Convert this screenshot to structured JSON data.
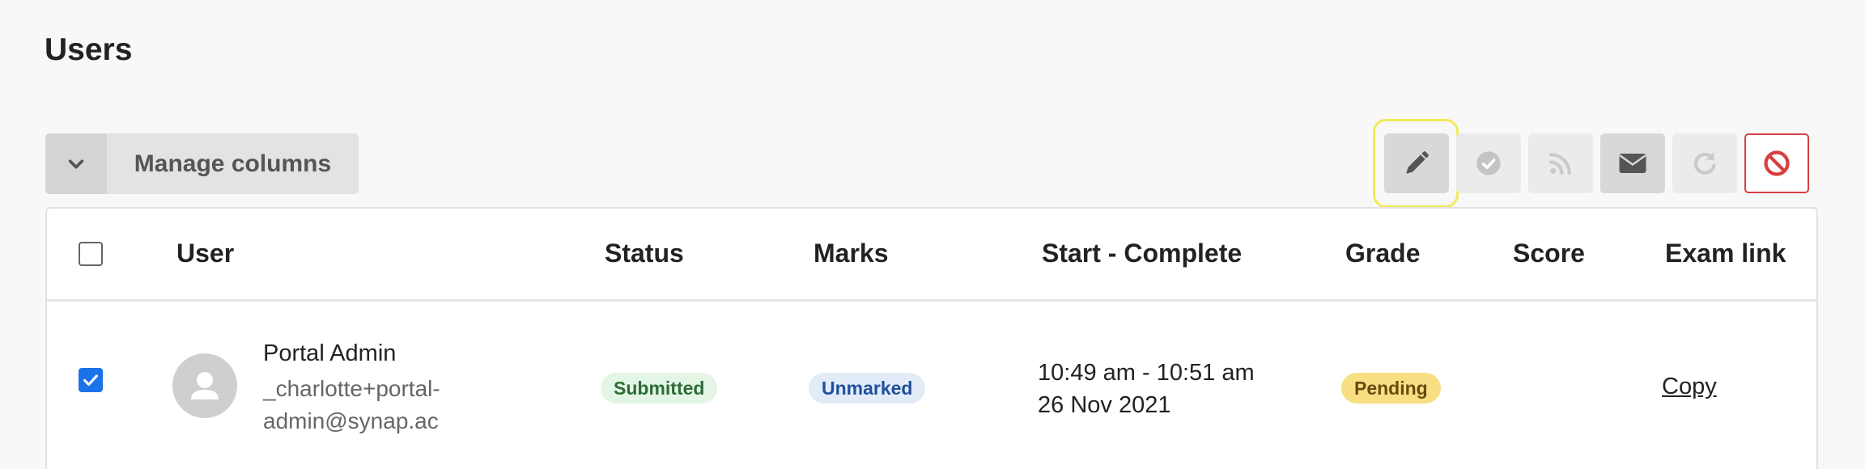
{
  "page": {
    "title": "Users"
  },
  "toolbar": {
    "manage_columns_label": "Manage columns",
    "buttons": [
      {
        "name": "edit",
        "icon": "pencil-icon",
        "highlighted": true
      },
      {
        "name": "mark",
        "icon": "check-circle-icon",
        "disabled": true
      },
      {
        "name": "feed",
        "icon": "rss-icon",
        "disabled": true
      },
      {
        "name": "email",
        "icon": "envelope-icon"
      },
      {
        "name": "reset",
        "icon": "redo-icon",
        "disabled": true
      },
      {
        "name": "block",
        "icon": "ban-icon",
        "color": "#d64040"
      }
    ]
  },
  "table": {
    "headers": {
      "user": "User",
      "status": "Status",
      "marks": "Marks",
      "start_complete": "Start - Complete",
      "grade": "Grade",
      "score": "Score",
      "exam_link": "Exam link"
    },
    "rows": [
      {
        "checked": true,
        "name": "Portal Admin",
        "email": "_charlotte+portal-admin@synap.ac",
        "status": "Submitted",
        "marks": "Unmarked",
        "time_range": "10:49 am - 10:51 am",
        "date": "26 Nov 2021",
        "grade": "Pending",
        "score": "",
        "exam_link": "Copy"
      }
    ]
  },
  "colors": {
    "accent": "#1a73e8",
    "danger": "#d64040",
    "highlight": "#f2ea5a",
    "status_green_bg": "#e3f6e6",
    "marks_blue_bg": "#e2ecf9",
    "grade_yellow_bg": "#f8df84"
  }
}
